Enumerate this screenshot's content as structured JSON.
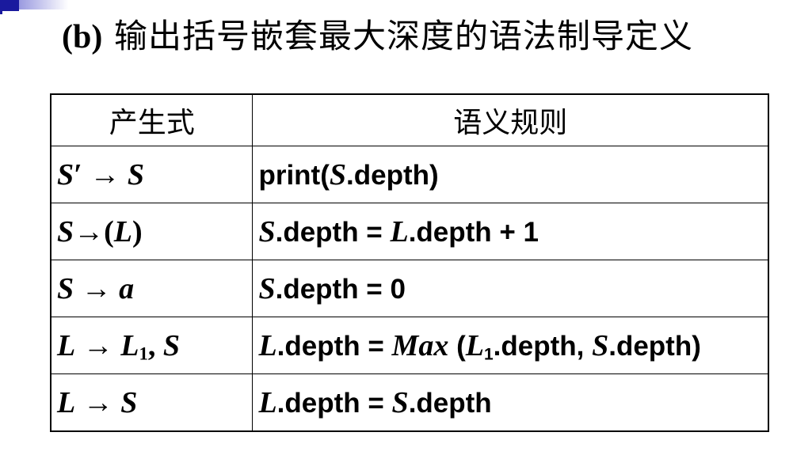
{
  "title": {
    "tag": "(b)",
    "text": "输出括号嵌套最大深度的语法制导定义"
  },
  "table": {
    "headers": [
      "产生式",
      "语义规则"
    ],
    "rows": [
      {
        "production": "S′ → S",
        "rule": "print(S.depth)"
      },
      {
        "production": "S→(L)",
        "rule": "S.depth = L.depth + 1"
      },
      {
        "production": "S → a",
        "rule": "S.depth = 0"
      },
      {
        "production": "L → L1, S",
        "rule": "L.depth = Max (L1.depth, S.depth)"
      },
      {
        "production": "L → S",
        "rule": "L.depth = S.depth"
      }
    ]
  },
  "colors": {
    "accent_dark": "#1a1a9e",
    "accent_light": "#c8c8f0"
  }
}
